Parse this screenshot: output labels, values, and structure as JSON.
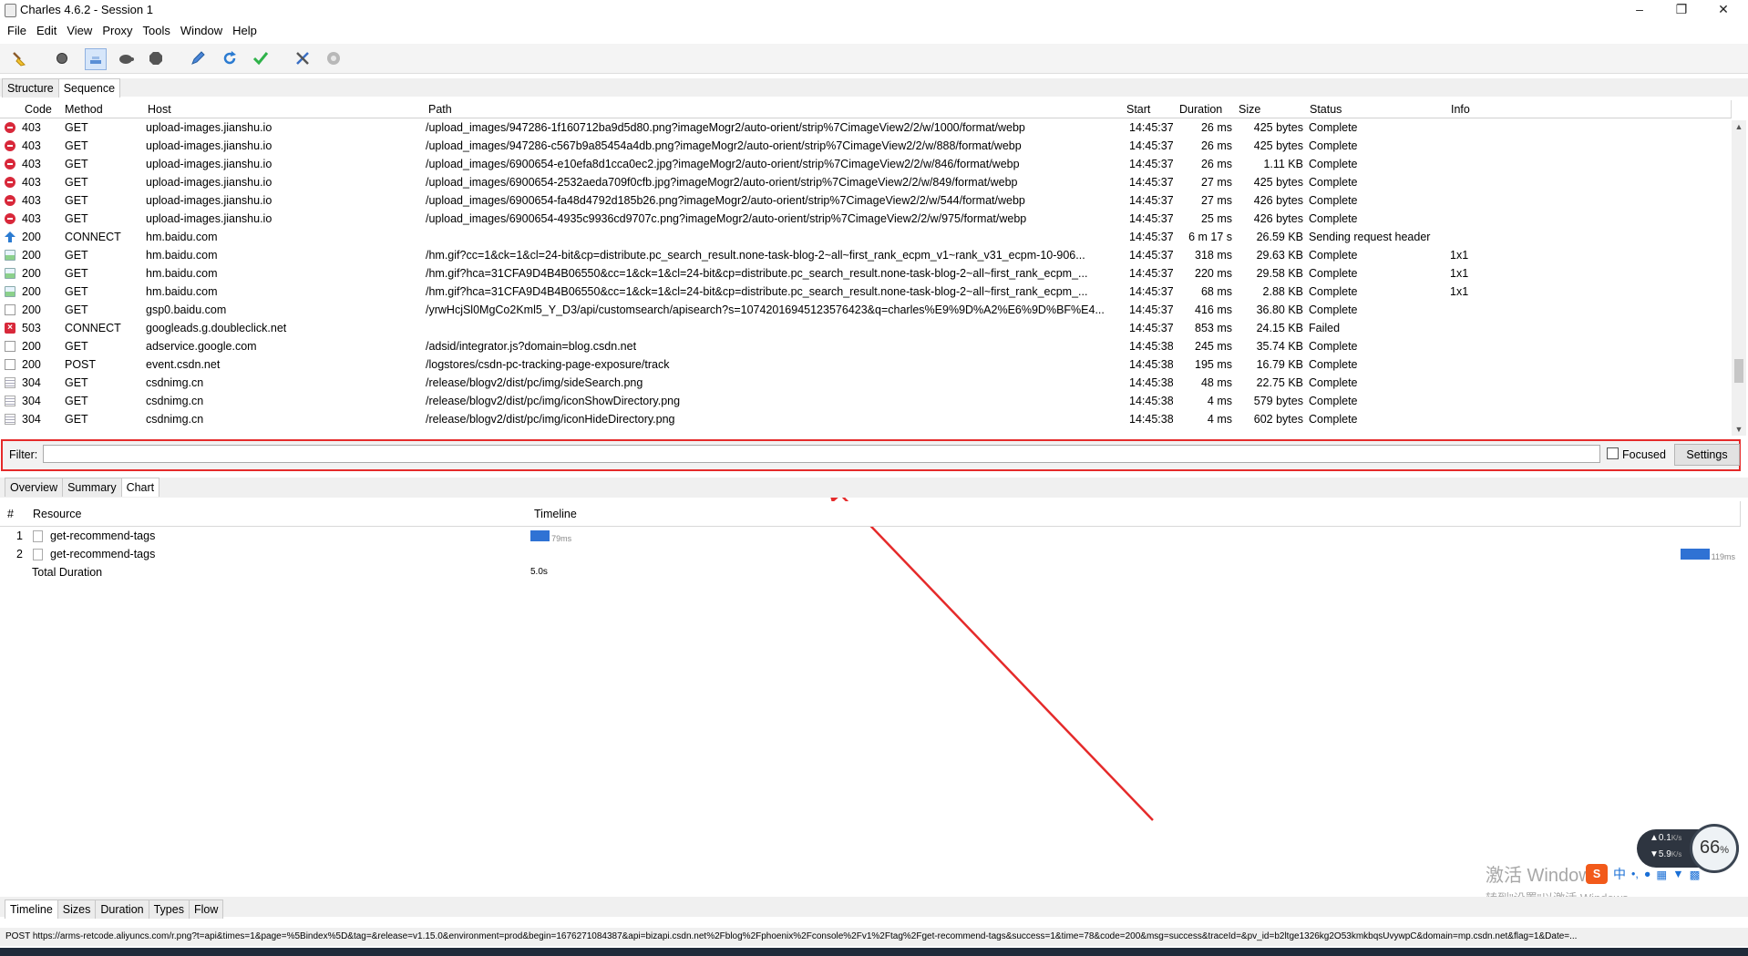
{
  "window": {
    "title": "Charles 4.6.2 - Session 1",
    "minimize": "–",
    "maximize": "❐",
    "close": "✕"
  },
  "menu": [
    "File",
    "Edit",
    "View",
    "Proxy",
    "Tools",
    "Window",
    "Help"
  ],
  "toolbar": {
    "icons": [
      "broom-icon",
      "record-icon",
      "throttle-icon",
      "turtle-icon",
      "stop-icon",
      "pen-icon",
      "refresh-icon",
      "check-icon",
      "tools-icon",
      "gear-icon"
    ]
  },
  "view_tabs": [
    "Structure",
    "Sequence"
  ],
  "request_table": {
    "columns": [
      "Code",
      "Method",
      "Host",
      "Path",
      "Start",
      "Duration",
      "Size",
      "Status",
      "Info"
    ],
    "rows": [
      {
        "icon": "forbidden",
        "code": "403",
        "method": "GET",
        "host": "upload-images.jianshu.io",
        "path": "/upload_images/947286-1f160712ba9d5d80.png?imageMogr2/auto-orient/strip%7CimageView2/2/w/1000/format/webp",
        "start": "14:45:37",
        "duration": "26 ms",
        "size": "425 bytes",
        "status": "Complete",
        "info": ""
      },
      {
        "icon": "forbidden",
        "code": "403",
        "method": "GET",
        "host": "upload-images.jianshu.io",
        "path": "/upload_images/947286-c567b9a85454a4db.png?imageMogr2/auto-orient/strip%7CimageView2/2/w/888/format/webp",
        "start": "14:45:37",
        "duration": "26 ms",
        "size": "425 bytes",
        "status": "Complete",
        "info": ""
      },
      {
        "icon": "forbidden",
        "code": "403",
        "method": "GET",
        "host": "upload-images.jianshu.io",
        "path": "/upload_images/6900654-e10efa8d1cca0ec2.jpg?imageMogr2/auto-orient/strip%7CimageView2/2/w/846/format/webp",
        "start": "14:45:37",
        "duration": "26 ms",
        "size": "1.11 KB",
        "status": "Complete",
        "info": ""
      },
      {
        "icon": "forbidden",
        "code": "403",
        "method": "GET",
        "host": "upload-images.jianshu.io",
        "path": "/upload_images/6900654-2532aeda709f0cfb.jpg?imageMogr2/auto-orient/strip%7CimageView2/2/w/849/format/webp",
        "start": "14:45:37",
        "duration": "27 ms",
        "size": "425 bytes",
        "status": "Complete",
        "info": ""
      },
      {
        "icon": "forbidden",
        "code": "403",
        "method": "GET",
        "host": "upload-images.jianshu.io",
        "path": "/upload_images/6900654-fa48d4792d185b26.png?imageMogr2/auto-orient/strip%7CimageView2/2/w/544/format/webp",
        "start": "14:45:37",
        "duration": "27 ms",
        "size": "426 bytes",
        "status": "Complete",
        "info": ""
      },
      {
        "icon": "forbidden",
        "code": "403",
        "method": "GET",
        "host": "upload-images.jianshu.io",
        "path": "/upload_images/6900654-4935c9936cd9707c.png?imageMogr2/auto-orient/strip%7CimageView2/2/w/975/format/webp",
        "start": "14:45:37",
        "duration": "25 ms",
        "size": "426 bytes",
        "status": "Complete",
        "info": ""
      },
      {
        "icon": "upload",
        "code": "200",
        "method": "CONNECT",
        "host": "hm.baidu.com",
        "path": "",
        "start": "14:45:37",
        "duration": "6 m 17 s",
        "size": "26.59 KB",
        "status": "Sending request header",
        "info": ""
      },
      {
        "icon": "image",
        "code": "200",
        "method": "GET",
        "host": "hm.baidu.com",
        "path": "/hm.gif?cc=1&ck=1&cl=24-bit&cp=distribute.pc_search_result.none-task-blog-2~all~first_rank_ecpm_v1~rank_v31_ecpm-10-906...",
        "start": "14:45:37",
        "duration": "318 ms",
        "size": "29.63 KB",
        "status": "Complete",
        "info": "1x1"
      },
      {
        "icon": "image",
        "code": "200",
        "method": "GET",
        "host": "hm.baidu.com",
        "path": "/hm.gif?hca=31CFA9D4B4B06550&cc=1&ck=1&cl=24-bit&cp=distribute.pc_search_result.none-task-blog-2~all~first_rank_ecpm_...",
        "start": "14:45:37",
        "duration": "220 ms",
        "size": "29.58 KB",
        "status": "Complete",
        "info": "1x1"
      },
      {
        "icon": "image",
        "code": "200",
        "method": "GET",
        "host": "hm.baidu.com",
        "path": "/hm.gif?hca=31CFA9D4B4B06550&cc=1&ck=1&cl=24-bit&cp=distribute.pc_search_result.none-task-blog-2~all~first_rank_ecpm_...",
        "start": "14:45:37",
        "duration": "68 ms",
        "size": "2.88 KB",
        "status": "Complete",
        "info": "1x1"
      },
      {
        "icon": "doc",
        "code": "200",
        "method": "GET",
        "host": "gsp0.baidu.com",
        "path": "/yrwHcjSl0MgCo2Kml5_Y_D3/api/customsearch/apisearch?s=10742016945123576423&q=charles%E9%9D%A2%E6%9D%BF%E4...",
        "start": "14:45:37",
        "duration": "416 ms",
        "size": "36.80 KB",
        "status": "Complete",
        "info": ""
      },
      {
        "icon": "failed",
        "code": "503",
        "method": "CONNECT",
        "host": "googleads.g.doubleclick.net",
        "path": "",
        "start": "14:45:37",
        "duration": "853 ms",
        "size": "24.15 KB",
        "status": "Failed",
        "info": ""
      },
      {
        "icon": "doc",
        "code": "200",
        "method": "GET",
        "host": "adservice.google.com",
        "path": "/adsid/integrator.js?domain=blog.csdn.net",
        "start": "14:45:38",
        "duration": "245 ms",
        "size": "35.74 KB",
        "status": "Complete",
        "info": ""
      },
      {
        "icon": "doc",
        "code": "200",
        "method": "POST",
        "host": "event.csdn.net",
        "path": "/logstores/csdn-pc-tracking-page-exposure/track",
        "start": "14:45:38",
        "duration": "195 ms",
        "size": "16.79 KB",
        "status": "Complete",
        "info": ""
      },
      {
        "icon": "text",
        "code": "304",
        "method": "GET",
        "host": "csdnimg.cn",
        "path": "/release/blogv2/dist/pc/img/sideSearch.png",
        "start": "14:45:38",
        "duration": "48 ms",
        "size": "22.75 KB",
        "status": "Complete",
        "info": ""
      },
      {
        "icon": "text",
        "code": "304",
        "method": "GET",
        "host": "csdnimg.cn",
        "path": "/release/blogv2/dist/pc/img/iconShowDirectory.png",
        "start": "14:45:38",
        "duration": "4 ms",
        "size": "579 bytes",
        "status": "Complete",
        "info": ""
      },
      {
        "icon": "text",
        "code": "304",
        "method": "GET",
        "host": "csdnimg.cn",
        "path": "/release/blogv2/dist/pc/img/iconHideDirectory.png",
        "start": "14:45:38",
        "duration": "4 ms",
        "size": "602 bytes",
        "status": "Complete",
        "info": ""
      }
    ]
  },
  "filter": {
    "label": "Filter:",
    "value": "",
    "focused_label": "Focused",
    "settings_label": "Settings"
  },
  "detail_tabs": [
    "Overview",
    "Summary",
    "Chart"
  ],
  "chart_table": {
    "columns": [
      "#",
      "Resource",
      "Timeline"
    ],
    "rows": [
      {
        "num": "1",
        "resource": "get-recommend-tags",
        "bar_label": "79ms",
        "offset_frac": 0.0,
        "width_frac": 0.016
      },
      {
        "num": "2",
        "resource": "get-recommend-tags",
        "bar_label": "119ms",
        "offset_frac": 0.976,
        "width_frac": 0.024
      }
    ],
    "total_label": "Total Duration",
    "total_value": "5.0s"
  },
  "bottom_tabs": [
    "Timeline",
    "Sizes",
    "Duration",
    "Types",
    "Flow"
  ],
  "status_text": "POST https://arms-retcode.aliyuncs.com/r.png?t=api&times=1&page=%5Bindex%5D&tag=&release=v1.15.0&environment=prod&begin=1676271084387&api=bizapi.csdn.net%2Fblog%2Fphoenix%2Fconsole%2Fv1%2Ftag%2Fget-recommend-tags&success=1&time=78&code=200&msg=success&traceId=&pv_id=b2ltge1326kg2O53kmkbqsUvywpC&domain=mp.csdn.net&flag=1&Date=...",
  "overlay": {
    "watermark_line1": "激活 Windows",
    "watermark_line2": "转到\"设置\"以激活 Windows。",
    "speed_up": "0.1",
    "speed_down": "5.9",
    "speed_unit": "K/s",
    "cpu_percent": "66",
    "percent_sign": "%"
  },
  "colors": {
    "highlight_border": "#e52a2a",
    "annotation_arrow": "#e52a2a",
    "timeline_bar": "#2f72d4"
  }
}
